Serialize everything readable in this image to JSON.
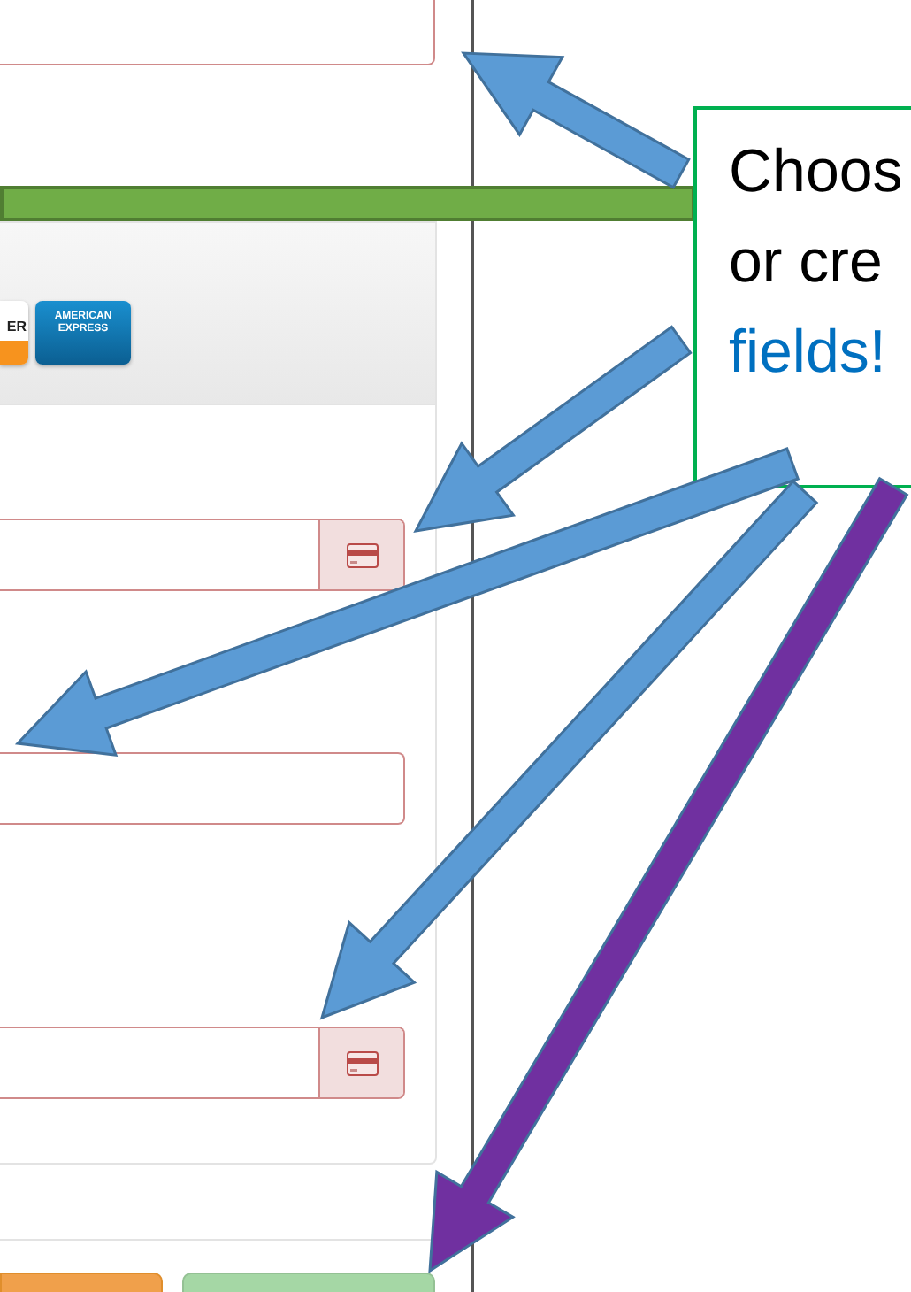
{
  "top_field": {
    "invalid": true
  },
  "card_logos": [
    {
      "kind": "discover",
      "text": "ER"
    },
    {
      "kind": "amex",
      "text": "AMERICAN EXPRESS"
    }
  ],
  "fields": [
    {
      "kind": "card-input",
      "invalid": true
    },
    {
      "kind": "text-input",
      "invalid": true
    },
    {
      "kind": "card-input",
      "invalid": true
    }
  ],
  "buttons": [
    {
      "kind": "warning",
      "disabled": false
    },
    {
      "kind": "success",
      "disabled": true
    }
  ],
  "callout": {
    "lines": [
      "Choos",
      "or cre",
      "**fields!**"
    ]
  },
  "arrows": [
    {
      "color": "#5b9bd5"
    },
    {
      "color": "#5b9bd5"
    },
    {
      "color": "#5b9bd5"
    },
    {
      "color": "#5b9bd5"
    },
    {
      "color": "#7030a0"
    }
  ]
}
